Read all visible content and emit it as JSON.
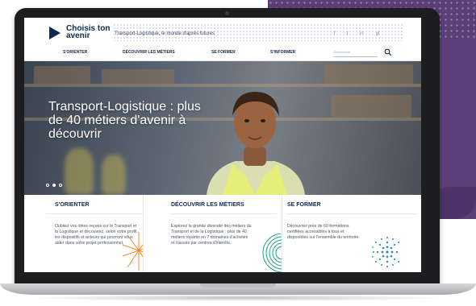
{
  "brand": {
    "logo_text": "Choisis ton avenir",
    "tagline": "Transport-Logistique, le monde d'après futures"
  },
  "social": [
    "f",
    "t",
    "in",
    "yt"
  ],
  "nav": {
    "items": [
      "S'ORIENTER",
      "DÉCOUVRIR LES MÉTIERS",
      "SE FORMER",
      "S'INFORMER"
    ],
    "search_placeholder": "Rechercher"
  },
  "hero": {
    "title": "Transport-Logistique : plus de 40 métiers d'avenir à découvrir",
    "slides": 3,
    "active_slide": 2
  },
  "cards": [
    {
      "title": "S'ORIENTER",
      "text": "Oubliez vos idées reçues sur le Transport et la Logistique et découvrez, selon votre profil, les dispositifs et acteurs qui pourront vous aider dans votre projet professionnel."
    },
    {
      "title": "DÉCOUVRIR LES MÉTIERS",
      "text": "Explorez la grande diversité des métiers du Transport et de la Logistique : plus de 40 métiers répartis en 7 domaines d'activités et classés par centres d'intérêts."
    },
    {
      "title": "SE FORMER",
      "text": "Découvrez près de 60 formations certifiées accessibles à tous et disponibles sur l'ensemble du territoire."
    }
  ],
  "colors": {
    "navy": "#0f2a4d",
    "purple": "#5b3f78",
    "orange": "#f08a24",
    "green": "#1fa37a",
    "teal": "#2a8fb0"
  },
  "icons": [
    "logo-chevron-icon",
    "search-icon",
    "facebook-icon",
    "twitter-icon",
    "linkedin-icon",
    "youtube-icon"
  ]
}
